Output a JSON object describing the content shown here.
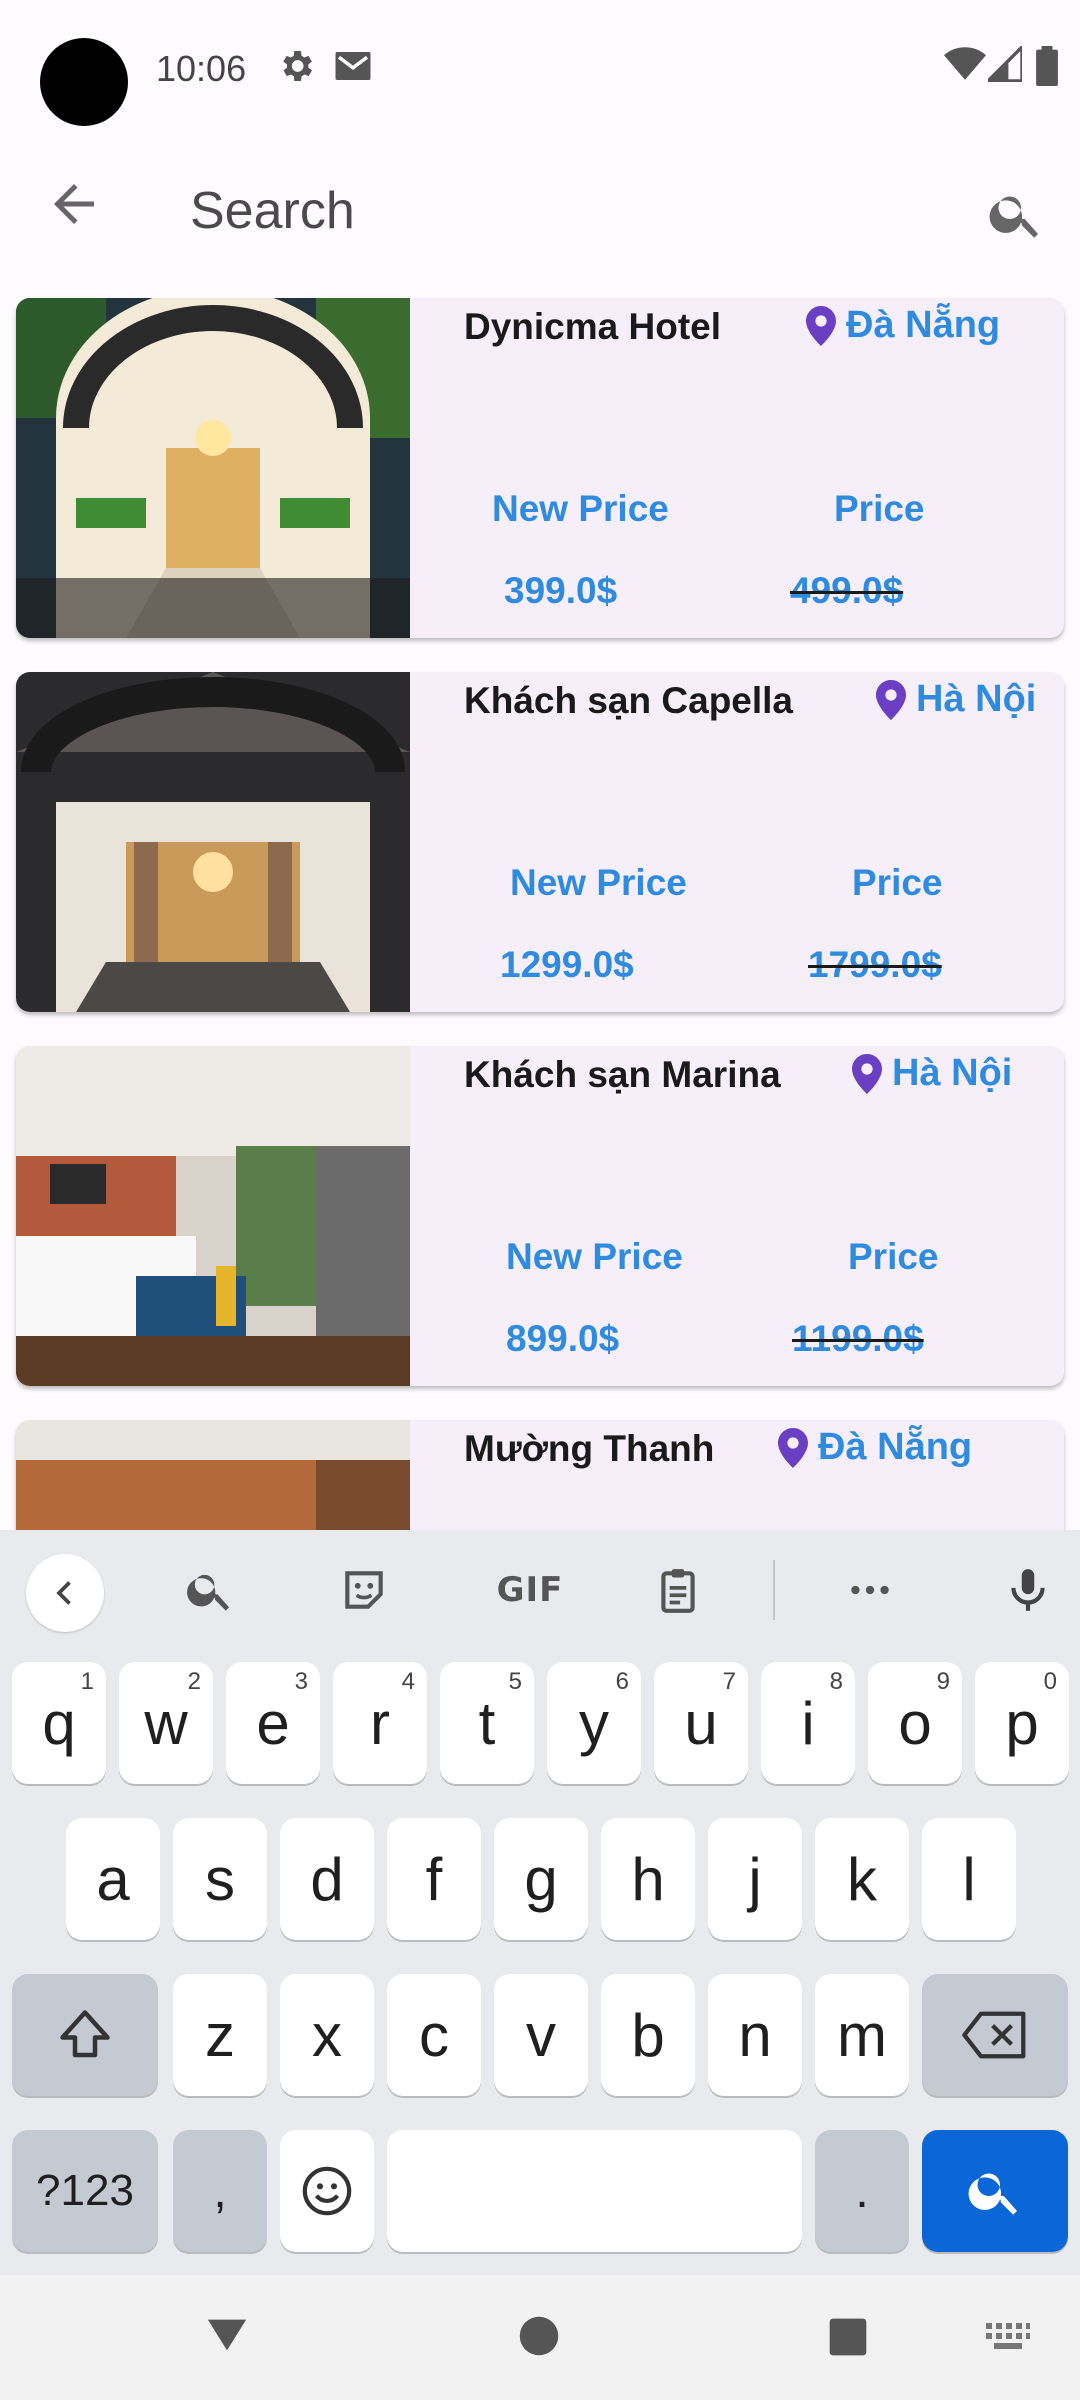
{
  "status_bar": {
    "time": "10:06",
    "icons": [
      "settings-icon",
      "mail-icon",
      "wifi-icon",
      "signal-icon",
      "battery-icon"
    ]
  },
  "app_bar": {
    "back_icon": "arrow-left-icon",
    "search_placeholder": "Search",
    "search_value": "",
    "search_icon": "search-icon"
  },
  "hotels": [
    {
      "name": "Dynicma Hotel",
      "location": "Đà Nẵng",
      "new_price_label": "New Price",
      "price_label": "Price",
      "new_price": "399.0$",
      "price": "499.0$"
    },
    {
      "name": "Khách sạn Capella",
      "location": "Hà Nội",
      "new_price_label": "New Price",
      "price_label": "Price",
      "new_price": "1299.0$",
      "price": "1799.0$"
    },
    {
      "name": "Khách sạn Marina",
      "location": "Hà Nội",
      "new_price_label": "New Price",
      "price_label": "Price",
      "new_price": "899.0$",
      "price": "1199.0$"
    },
    {
      "name": "Mường Thanh",
      "location": "Đà Nẵng"
    }
  ],
  "keyboard": {
    "suggestion_strip": {
      "collapse_icon": "chevron-left-icon",
      "items": [
        "search-icon",
        "sticker-icon",
        "gif-icon",
        "clipboard-icon",
        "more-icon",
        "mic-icon"
      ],
      "gif_label": "GIF"
    },
    "row1": [
      {
        "key": "q",
        "hint": "1"
      },
      {
        "key": "w",
        "hint": "2"
      },
      {
        "key": "e",
        "hint": "3"
      },
      {
        "key": "r",
        "hint": "4"
      },
      {
        "key": "t",
        "hint": "5"
      },
      {
        "key": "y",
        "hint": "6"
      },
      {
        "key": "u",
        "hint": "7"
      },
      {
        "key": "i",
        "hint": "8"
      },
      {
        "key": "o",
        "hint": "9"
      },
      {
        "key": "p",
        "hint": "0"
      }
    ],
    "row2": [
      "a",
      "s",
      "d",
      "f",
      "g",
      "h",
      "j",
      "k",
      "l"
    ],
    "row3": [
      "z",
      "x",
      "c",
      "v",
      "b",
      "n",
      "m"
    ],
    "row4": {
      "symbols": "?123",
      "comma": ",",
      "period": "."
    },
    "colors": {
      "action": "#0b66d8",
      "modifier": "#c4c9d2",
      "key": "#ffffff",
      "background": "#e8eaed"
    }
  },
  "nav_bar": {
    "icons": [
      "back-triangle-icon",
      "home-circle-icon",
      "recents-square-icon",
      "keyboard-switch-icon"
    ]
  },
  "colors": {
    "accent": "#2f8be0",
    "pin": "#6a3fc4",
    "card": "#f6eef9"
  }
}
